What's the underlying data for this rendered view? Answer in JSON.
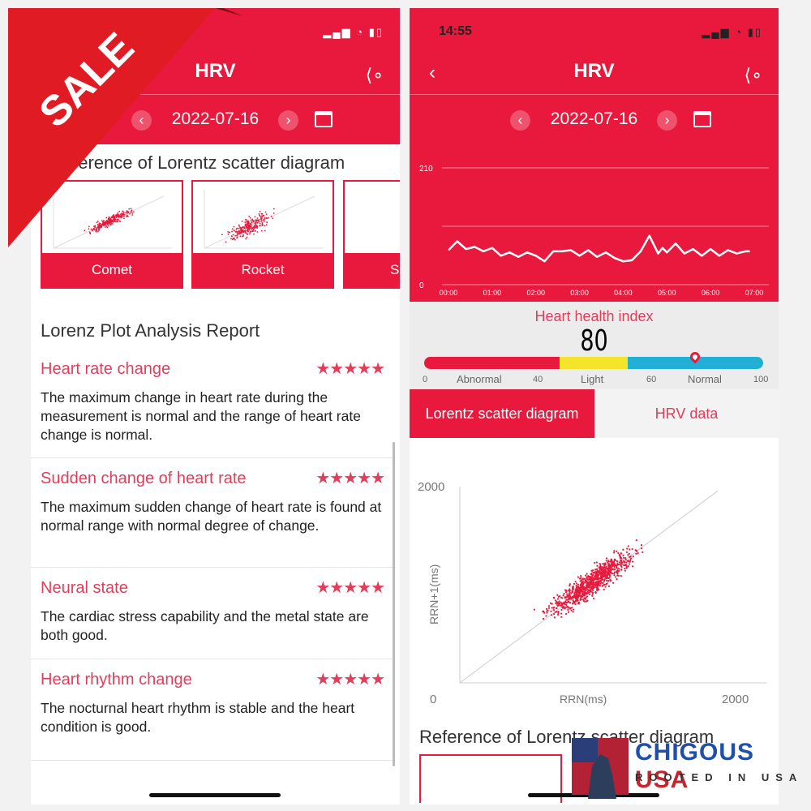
{
  "promo": {
    "sale_label": "SALE",
    "brand_name": "CHIGOUS",
    "brand_country": "USA",
    "brand_tagline": "ROOTED IN USA"
  },
  "colors": {
    "accent": "#e8193c",
    "abnormal": "#e8193c",
    "light": "#f4e52a",
    "normal": "#22afd6"
  },
  "left": {
    "title": "HRV",
    "date": "2022-07-16",
    "reference_title": "Reference of Lorentz scatter diagram",
    "reference_cards": [
      {
        "label": "Comet"
      },
      {
        "label": "Rocket"
      },
      {
        "label": "S"
      }
    ],
    "report_title": "Lorenz Plot Analysis Report",
    "report_items": [
      {
        "title": "Heart rate change",
        "stars": "★★★★★",
        "rating": 5,
        "text": "The maximum change in heart rate during the measurement is normal and the range of heart rate change is normal."
      },
      {
        "title": "Sudden change of heart rate",
        "stars": "★★★★★",
        "rating": 5,
        "text": "The maximum sudden change of heart rate is found at normal range with normal degree of change."
      },
      {
        "title": "Neural state",
        "stars": "★★★★★",
        "rating": 5,
        "text": "The cardiac stress capability and the metal state are both good."
      },
      {
        "title": "Heart rhythm change",
        "stars": "★★★★★",
        "rating": 5,
        "text": "The nocturnal heart rhythm is stable and the heart condition is good."
      }
    ]
  },
  "right": {
    "time": "14:55",
    "title": "HRV",
    "date": "2022-07-16",
    "hrv_chart": {
      "type": "line",
      "ylim": [
        0,
        210
      ],
      "y_ticks": [
        "210",
        "0"
      ],
      "x_ticks": [
        "00:00",
        "01:00",
        "02:00",
        "03:00",
        "04:00",
        "05:00",
        "06:00",
        "07:00"
      ],
      "x": [
        0,
        0.2,
        0.4,
        0.6,
        0.8,
        1.0,
        1.2,
        1.4,
        1.6,
        1.8,
        2.0,
        2.2,
        2.4,
        2.6,
        2.8,
        3.0,
        3.2,
        3.4,
        3.6,
        3.8,
        4.0,
        4.2,
        4.4,
        4.6,
        4.8,
        4.9,
        5.0,
        5.2,
        5.4,
        5.6,
        5.8,
        6.0,
        6.2,
        6.4,
        6.6,
        6.8,
        6.9
      ],
      "values": [
        62,
        78,
        64,
        68,
        60,
        66,
        52,
        58,
        50,
        58,
        52,
        42,
        60,
        60,
        62,
        52,
        62,
        50,
        58,
        48,
        42,
        44,
        60,
        88,
        56,
        66,
        58,
        74,
        56,
        64,
        52,
        64,
        52,
        62,
        56,
        60,
        60
      ]
    },
    "health": {
      "label": "Heart health index",
      "value": "80",
      "score": 80,
      "scale": [
        "0",
        "40",
        "60",
        "100"
      ],
      "zones": [
        "Abnormal",
        "Light",
        "Normal"
      ]
    },
    "tabs": [
      {
        "label": "Lorentz scatter diagram",
        "active": true
      },
      {
        "label": "HRV data",
        "active": false
      }
    ],
    "scatter": {
      "type": "scatter",
      "xlabel": "RRN(ms)",
      "ylabel": "RRN+1(ms)",
      "xlim": [
        0,
        2000
      ],
      "ylim": [
        0,
        2000
      ],
      "x_ticks": [
        "0",
        "2000"
      ],
      "y_ticks": [
        "2000"
      ]
    },
    "reference_title": "Reference of Lorentz scatter diagram"
  }
}
